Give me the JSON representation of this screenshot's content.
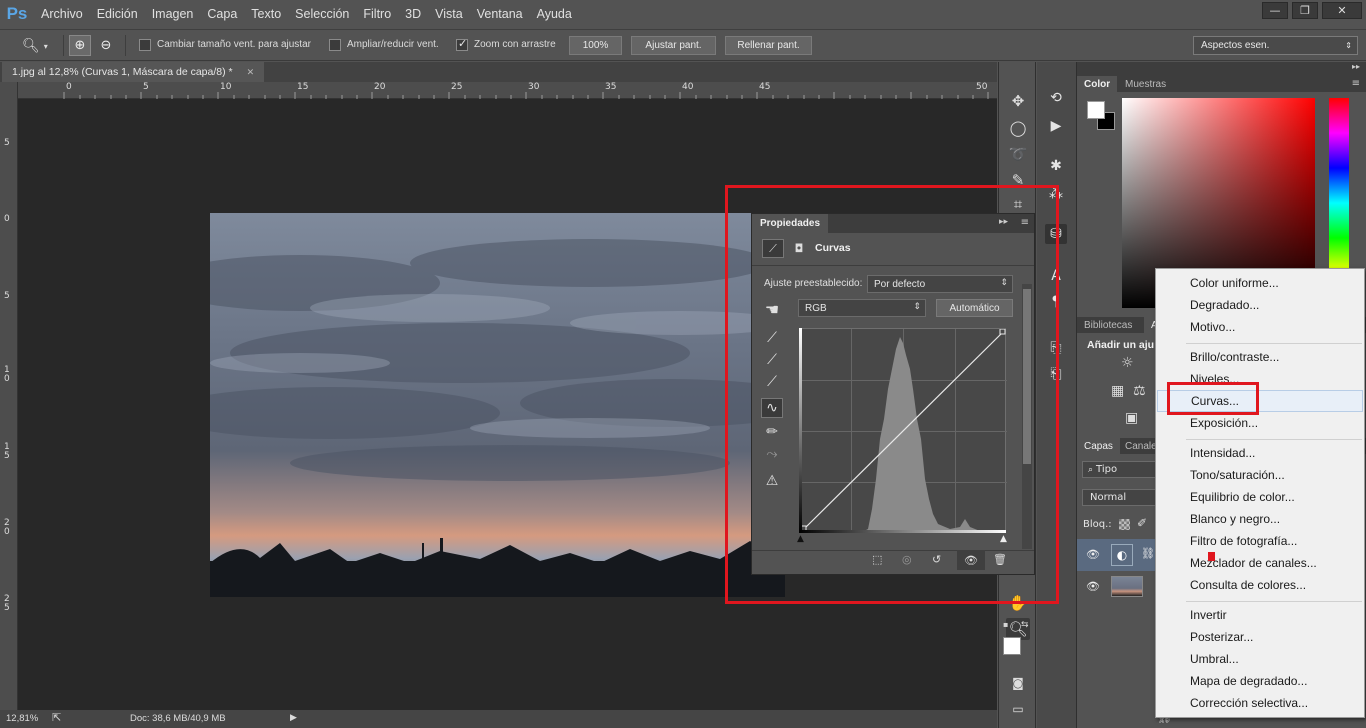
{
  "app": {
    "logo": "Ps",
    "menu": [
      "Archivo",
      "Edición",
      "Imagen",
      "Capa",
      "Texto",
      "Selección",
      "Filtro",
      "3D",
      "Vista",
      "Ventana",
      "Ayuda"
    ]
  },
  "options": {
    "resize_window": "Cambiar tamaño vent. para ajustar",
    "zoom_all": "Ampliar/reducir vent.",
    "scrubby_zoom": "Zoom con arrastre",
    "zoom_100": "100%",
    "fit_screen": "Ajustar pant.",
    "fill_screen": "Rellenar pant.",
    "workspace": "Aspectos esen."
  },
  "document": {
    "tab_title": "1.jpg al 12,8% (Curvas 1, Máscara de capa/8) *",
    "ruler_h": [
      "0",
      "5",
      "10",
      "15",
      "20",
      "25",
      "30",
      "35",
      "40",
      "45",
      "50"
    ],
    "ruler_v": [
      "5",
      "0",
      "5",
      "1\n0",
      "1\n5",
      "2\n0",
      "2\n5"
    ]
  },
  "status": {
    "zoom": "12,81%",
    "doc": "Doc: 38,6 MB/40,9 MB"
  },
  "properties": {
    "tab": "Propiedades",
    "title": "Curvas",
    "preset_label": "Ajuste preestablecido:",
    "preset_value": "Por defecto",
    "channel": "RGB",
    "auto_button": "Automático"
  },
  "color_panel": {
    "tabs": [
      "Color",
      "Muestras"
    ]
  },
  "adjust_panel": {
    "tab": "Bibliotecas",
    "tab2": "A",
    "heading": "Añadir un aju"
  },
  "layers_panel": {
    "tabs": [
      "Capas",
      "Canale"
    ],
    "filter": "Tipo",
    "blend_mode": "Normal",
    "lock_label": "Bloq.:"
  },
  "context_menu": {
    "groups": [
      [
        "Color uniforme...",
        "Degradado...",
        "Motivo..."
      ],
      [
        "Brillo/contraste...",
        "Niveles...",
        "Curvas...",
        "Exposición..."
      ],
      [
        "Intensidad...",
        "Tono/saturación...",
        "Equilibrio de color...",
        "Blanco y negro...",
        "Filtro de fotografía...",
        "Mezclador de canales...",
        "Consulta de colores..."
      ],
      [
        "Invertir",
        "Posterizar...",
        "Umbral...",
        "Mapa de degradado...",
        "Corrección selectiva..."
      ]
    ],
    "highlighted": "Curvas..."
  },
  "colors": {
    "annotation_red": "#e0161e",
    "ps_blue": "#5aa6e6",
    "menu_highlight": "#e8eff8"
  }
}
